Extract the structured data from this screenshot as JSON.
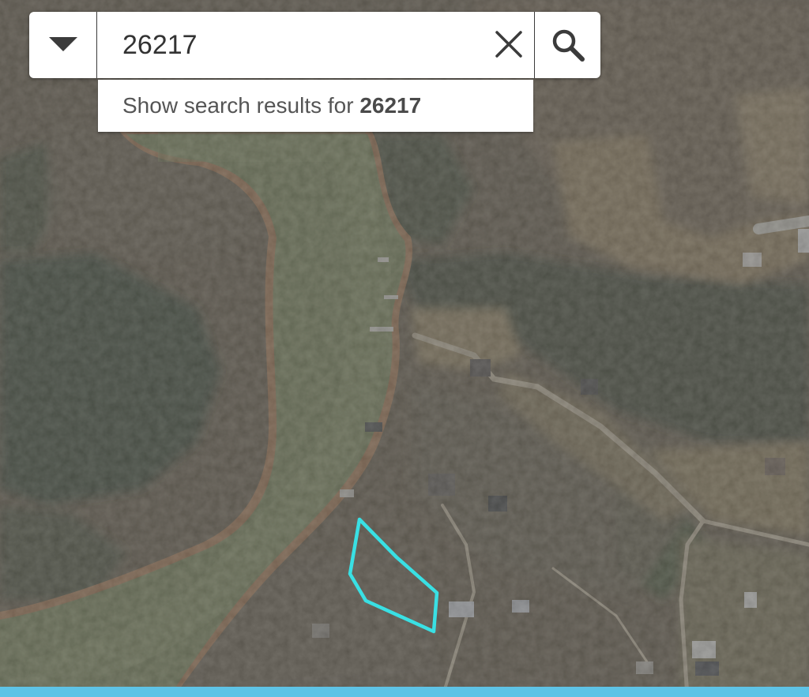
{
  "search": {
    "query": "26217",
    "dropdown_icon": "caret-down-icon",
    "clear_icon": "close-icon",
    "search_icon": "magnifier-icon"
  },
  "suggestion": {
    "prefix": "Show search results for ",
    "term": "26217"
  },
  "map": {
    "type": "satellite-imagery",
    "parcel_outline_color": "#39e0e4",
    "water_color": "#6e7a4a",
    "forest_color": "#514834",
    "footer_strip_color": "#5ec3e6"
  }
}
